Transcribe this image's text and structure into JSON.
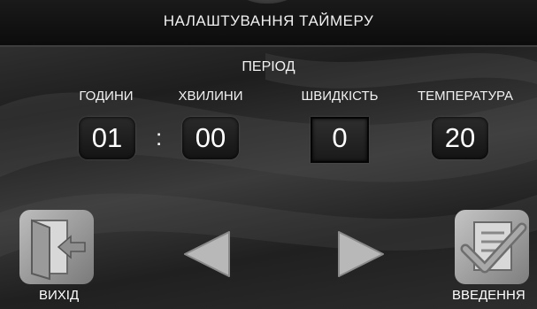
{
  "header": {
    "title": "НАЛАШТУВАННЯ ТАЙМЕРУ"
  },
  "section": {
    "label": "ПЕРІОД"
  },
  "fields": [
    {
      "label": "ГОДИНИ",
      "value": "01"
    },
    {
      "label": "ХВИЛИНИ",
      "value": "00"
    },
    {
      "label": "ШВИДКІСТЬ",
      "value": "0"
    },
    {
      "label": "ТЕМПЕРАТУРА",
      "value": "20"
    }
  ],
  "separator": ":",
  "buttons": {
    "exit_label": "ВИХІД",
    "enter_label": "ВВЕДЕННЯ"
  },
  "icons": {
    "exit": "exit-door-icon",
    "prev": "arrow-left-icon",
    "next": "arrow-right-icon",
    "enter": "checkmark-document-icon"
  }
}
